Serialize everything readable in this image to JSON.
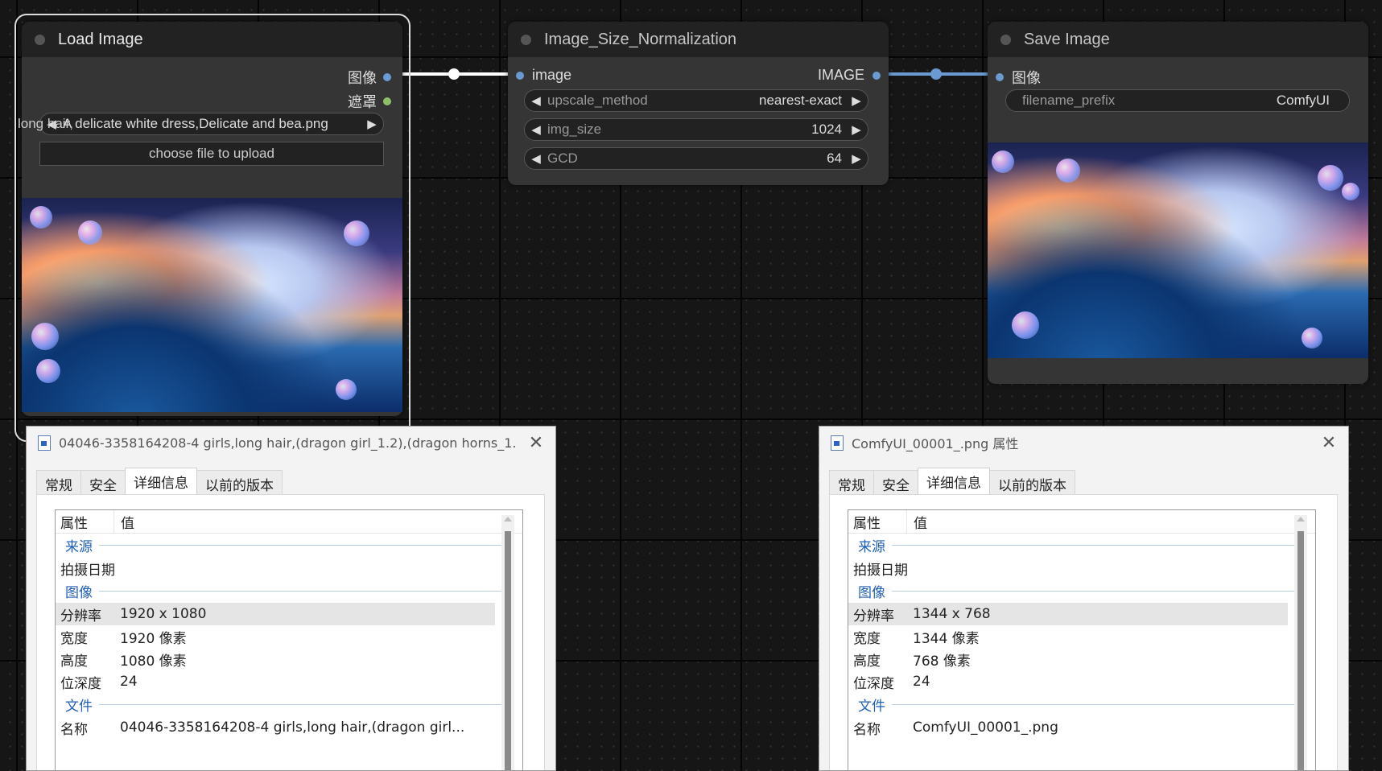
{
  "colors": {
    "canvas_bg": "#161616",
    "node_body": "#353535",
    "node_title_bg": "#222222",
    "link_color": "#ffffff",
    "link_image_color": "#6a9ad0",
    "mask_slot_color": "#8fbf6a"
  },
  "load_image": {
    "title": "Load Image",
    "output_image": "图像",
    "output_mask": "遮罩",
    "file_value": "A delicate white dress,Delicate and bea.png",
    "file_value_behind": "long hair,",
    "upload_button": "choose file to upload"
  },
  "normalize": {
    "title": "Image_Size_Normalization",
    "input_image": "image",
    "output_image": "IMAGE",
    "widgets": [
      {
        "label": "upscale_method",
        "value": "nearest-exact"
      },
      {
        "label": "img_size",
        "value": "1024"
      },
      {
        "label": "GCD",
        "value": "64"
      }
    ]
  },
  "save_image": {
    "title": "Save Image",
    "input_image": "图像",
    "prefix_label": "filename_prefix",
    "prefix_value": "ComfyUI"
  },
  "dialog_left": {
    "title": "04046-3358164208-4 girls,long hair,(dragon girl_1.2),(dragon horns_1....",
    "tabs": [
      "常规",
      "安全",
      "详细信息",
      "以前的版本"
    ],
    "active_tab": 2,
    "col_property": "属性",
    "col_value": "值",
    "group_source": "来源",
    "date_taken": "拍摄日期",
    "group_image": "图像",
    "rows_image": [
      {
        "k": "分辨率",
        "v": "1920 x 1080"
      },
      {
        "k": "宽度",
        "v": "1920 像素"
      },
      {
        "k": "高度",
        "v": "1080 像素"
      },
      {
        "k": "位深度",
        "v": "24"
      }
    ],
    "group_file": "文件",
    "name_label": "名称",
    "name_value": "04046-3358164208-4 girls,long hair,(dragon girl..."
  },
  "dialog_right": {
    "title": "ComfyUI_00001_.png 属性",
    "tabs": [
      "常规",
      "安全",
      "详细信息",
      "以前的版本"
    ],
    "active_tab": 2,
    "col_property": "属性",
    "col_value": "值",
    "group_source": "来源",
    "date_taken": "拍摄日期",
    "group_image": "图像",
    "rows_image": [
      {
        "k": "分辨率",
        "v": "1344 x 768"
      },
      {
        "k": "宽度",
        "v": "1344 像素"
      },
      {
        "k": "高度",
        "v": "768 像素"
      },
      {
        "k": "位深度",
        "v": "24"
      }
    ],
    "group_file": "文件",
    "name_label": "名称",
    "name_value": "ComfyUI_00001_.png"
  }
}
